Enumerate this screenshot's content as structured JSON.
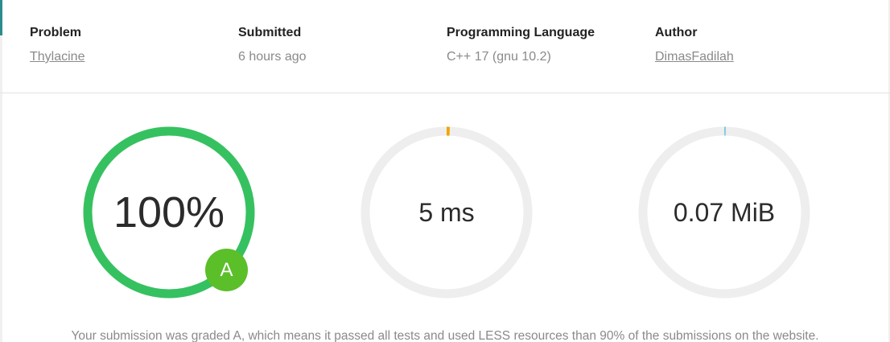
{
  "info": {
    "problem": {
      "label": "Problem",
      "value": "Thylacine"
    },
    "submitted": {
      "label": "Submitted",
      "value": "6 hours ago"
    },
    "language": {
      "label": "Programming Language",
      "value": "C++ 17 (gnu 10.2)"
    },
    "author": {
      "label": "Author",
      "value": "DimasFadilah"
    }
  },
  "gauges": {
    "score": {
      "value": "100%",
      "fraction": 1.0,
      "color": "#36c160",
      "track": "#eeeeee"
    },
    "time": {
      "value": "5 ms",
      "fraction": 0.006,
      "color": "#f0a500",
      "track": "#eeeeee"
    },
    "memory": {
      "value": "0.07 MiB",
      "fraction": 0.003,
      "color": "#7fc8e0",
      "track": "#eeeeee"
    }
  },
  "grade": {
    "letter": "A",
    "color": "#5bbf2a"
  },
  "summary": "Your submission was graded A, which means it passed all tests and used LESS resources than 90% of the submissions on the website."
}
